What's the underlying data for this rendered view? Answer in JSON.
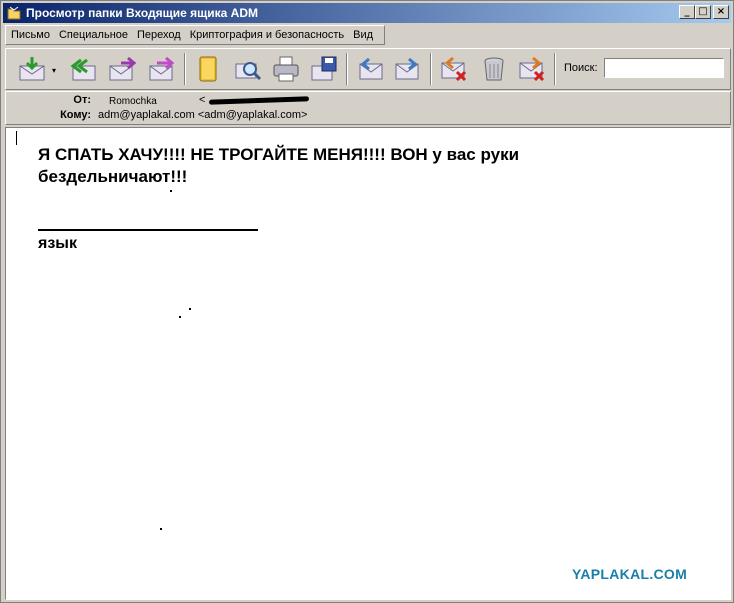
{
  "window": {
    "title": "Просмотр папки Входящие ящика ADM",
    "controls": [
      "_",
      "□",
      "×"
    ]
  },
  "menu": [
    {
      "label": "Письмо"
    },
    {
      "label": "Специальное"
    },
    {
      "label": "Переход"
    },
    {
      "label": "Криптография и безопасность"
    },
    {
      "label": "Вид"
    }
  ],
  "toolbar": {
    "icons": [
      "get-mail-icon",
      "reply-icon",
      "reply-all-icon",
      "forward-icon",
      "redirect-icon",
      "address-book-icon",
      "find-icon",
      "print-icon",
      "save-icon",
      "previous-icon",
      "next-icon",
      "delete-icon",
      "trash-icon",
      "spam-icon"
    ],
    "search_label": "Поиск:",
    "search_value": ""
  },
  "headers": {
    "from_label": "От:",
    "from_name": "Romochka",
    "from_bracket": "<",
    "to_label": "Кому:",
    "to_value": "adm@yaplakal.com <adm@yaplakal.com>"
  },
  "message": {
    "line1": "Я СПАТЬ ХАЧУ!!!! НЕ ТРОГАЙТЕ МЕНЯ!!!! ВОН у вас руки",
    "line2": "бездельничают!!!",
    "signature": "язык"
  },
  "watermark": "YAPLAKAL.COM",
  "colors": {
    "titlebar_start": "#0a246a",
    "titlebar_end": "#a6caf0",
    "chrome": "#d4d0c8",
    "watermark": "#1a7fa8"
  }
}
